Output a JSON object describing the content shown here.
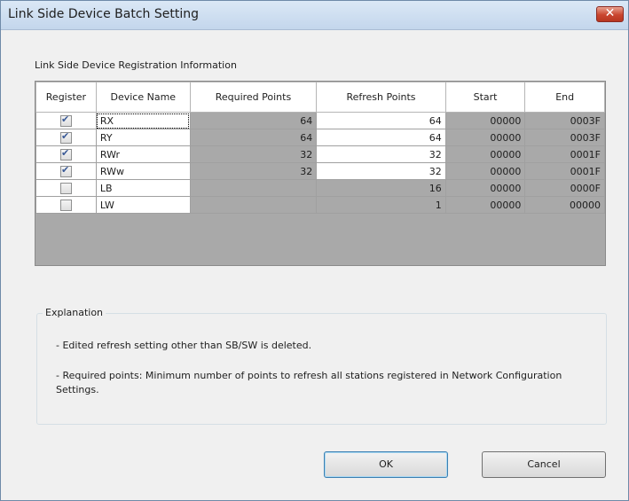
{
  "window": {
    "title": "Link Side Device Batch Setting"
  },
  "section": {
    "label": "Link Side Device Registration Information"
  },
  "table": {
    "headers": [
      "Register",
      "Device Name",
      "Required Points",
      "Refresh Points",
      "Start",
      "End"
    ],
    "rows": [
      {
        "checked": true,
        "name": "RX",
        "required": "64",
        "refresh": "64",
        "start": "00000",
        "end": "0003F"
      },
      {
        "checked": true,
        "name": "RY",
        "required": "64",
        "refresh": "64",
        "start": "00000",
        "end": "0003F"
      },
      {
        "checked": true,
        "name": "RWr",
        "required": "32",
        "refresh": "32",
        "start": "00000",
        "end": "0001F"
      },
      {
        "checked": true,
        "name": "RWw",
        "required": "32",
        "refresh": "32",
        "start": "00000",
        "end": "0001F"
      },
      {
        "checked": false,
        "name": "LB",
        "required": "",
        "refresh": "16",
        "start": "00000",
        "end": "0000F"
      },
      {
        "checked": false,
        "name": "LW",
        "required": "",
        "refresh": "1",
        "start": "00000",
        "end": "00000"
      }
    ]
  },
  "explanation": {
    "legend": "Explanation",
    "line1": "- Edited refresh setting other than SB/SW is deleted.",
    "line2": "- Required points: Minimum number of points to refresh all stations registered in Network Configuration",
    "line3": "Settings."
  },
  "buttons": {
    "ok": "OK",
    "cancel": "Cancel"
  },
  "colors": {
    "titlebar": "#c3d6ec",
    "close": "#c9462f",
    "readonly_cell": "#a9a9a9",
    "checkmark": "#3a5a96"
  }
}
